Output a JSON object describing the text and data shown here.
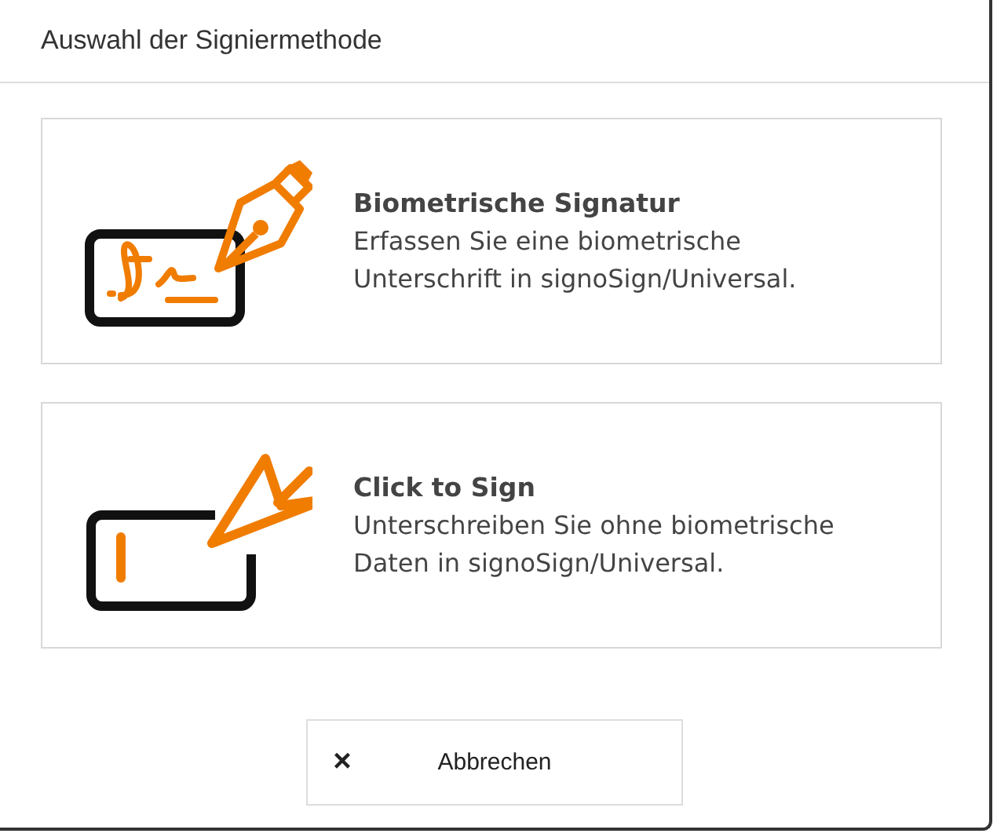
{
  "dialog": {
    "title": "Auswahl der Signiermethode"
  },
  "options": [
    {
      "kind": "pen",
      "title": "Biometrische Signatur",
      "description": "Erfassen Sie eine biometrische Unterschrift in signoSign/Universal."
    },
    {
      "kind": "tap",
      "title": "Click to Sign",
      "description": "Unterschreiben Sie ohne biometrische Daten in signoSign/Universal."
    }
  ],
  "cancel_button": {
    "icon": "×",
    "label": "Abbrechen"
  }
}
